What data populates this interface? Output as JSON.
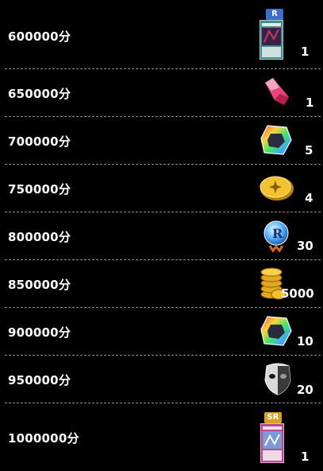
{
  "rewards": [
    {
      "score": "600000分",
      "item_icon": "card-icon",
      "rarity": "R",
      "quantity": "1"
    },
    {
      "score": "650000分",
      "item_icon": "crystal-pink-icon",
      "quantity": "1"
    },
    {
      "score": "700000分",
      "item_icon": "rainbow-gem-icon",
      "quantity": "5"
    },
    {
      "score": "750000分",
      "item_icon": "gold-coin-icon",
      "quantity": "4"
    },
    {
      "score": "800000分",
      "item_icon": "blue-orb-icon",
      "quantity": "30"
    },
    {
      "score": "850000分",
      "item_icon": "gold-stack-icon",
      "quantity": "5000"
    },
    {
      "score": "900000分",
      "item_icon": "rainbow-gem-icon",
      "quantity": "10"
    },
    {
      "score": "950000分",
      "item_icon": "mask-shield-icon",
      "quantity": "20"
    },
    {
      "score": "1000000分",
      "item_icon": "card-icon",
      "rarity": "SR",
      "quantity": "1"
    }
  ],
  "colors": {
    "background": "#000000",
    "separator": "#8c8c8c",
    "text": "#ffffff",
    "rarity_r": "#3b6fc9",
    "rarity_sr": "#d8a21c"
  }
}
